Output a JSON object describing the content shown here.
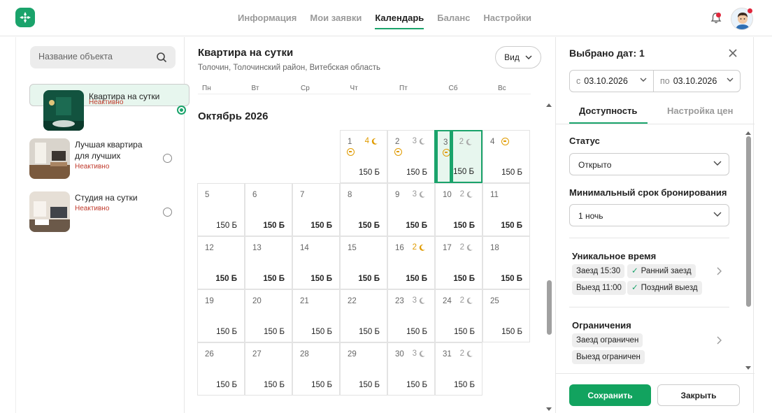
{
  "nav": {
    "items": [
      {
        "label": "Информация",
        "active": false
      },
      {
        "label": "Мои заявки",
        "active": false
      },
      {
        "label": "Календарь",
        "active": true
      },
      {
        "label": "Баланс",
        "active": false
      },
      {
        "label": "Настройки",
        "active": false
      }
    ]
  },
  "colors": {
    "accent": "#1aa36b",
    "warning": "#e09b00",
    "inactive": "#c0392b"
  },
  "search": {
    "placeholder": "Название объекта"
  },
  "objects": [
    {
      "name": "Квартира на сутки",
      "status": "Неактивно",
      "selected": true
    },
    {
      "name": "Лучшая квартира для лучших",
      "status": "Неактивно",
      "selected": false
    },
    {
      "name": "Студия на сутки",
      "status": "Неактивно",
      "selected": false
    }
  ],
  "calendar": {
    "title": "Квартира на сутки",
    "subtitle": "Толочин, Толочинский район, Витебская область",
    "view_label": "Вид",
    "weekdays": [
      "Пн",
      "Вт",
      "Ср",
      "Чт",
      "Пт",
      "Сб",
      "Вс"
    ],
    "month": "Октябрь 2026",
    "first_weekday_index": 3,
    "days": [
      {
        "d": "1",
        "nights": "4",
        "night_color": "orange",
        "blocked": true,
        "price": "150 Б",
        "bold": false
      },
      {
        "d": "2",
        "nights": "3",
        "night_color": "grey",
        "blocked": true,
        "price": "150 Б",
        "bold": false
      },
      {
        "d": "3",
        "nights": "2",
        "night_color": "grey",
        "blocked": true,
        "price": "150 Б",
        "bold": false,
        "selected": true
      },
      {
        "d": "4",
        "nights": "",
        "night_color": "",
        "blocked": true,
        "price": "150 Б",
        "bold": false
      },
      {
        "d": "5",
        "nights": "",
        "price": "150 Б",
        "bold": false
      },
      {
        "d": "6",
        "nights": "",
        "price": "150 Б",
        "bold": true
      },
      {
        "d": "7",
        "nights": "",
        "price": "150 Б",
        "bold": true
      },
      {
        "d": "8",
        "nights": "",
        "price": "150 Б",
        "bold": true
      },
      {
        "d": "9",
        "nights": "3",
        "night_color": "grey",
        "price": "150 Б",
        "bold": true
      },
      {
        "d": "10",
        "nights": "2",
        "night_color": "grey",
        "price": "150 Б",
        "bold": true
      },
      {
        "d": "11",
        "nights": "",
        "price": "150 Б",
        "bold": true
      },
      {
        "d": "12",
        "nights": "",
        "price": "150 Б",
        "bold": true
      },
      {
        "d": "13",
        "nights": "",
        "price": "150 Б",
        "bold": true
      },
      {
        "d": "14",
        "nights": "",
        "price": "150 Б",
        "bold": true
      },
      {
        "d": "15",
        "nights": "",
        "price": "150 Б",
        "bold": true
      },
      {
        "d": "16",
        "nights": "2",
        "night_color": "orange",
        "price": "150 Б",
        "bold": true
      },
      {
        "d": "17",
        "nights": "2",
        "night_color": "grey",
        "price": "150 Б",
        "bold": true
      },
      {
        "d": "18",
        "nights": "",
        "price": "150 Б",
        "bold": true
      },
      {
        "d": "19",
        "nights": "",
        "price": "150 Б",
        "bold": false
      },
      {
        "d": "20",
        "nights": "",
        "price": "150 Б",
        "bold": false
      },
      {
        "d": "21",
        "nights": "",
        "price": "150 Б",
        "bold": false
      },
      {
        "d": "22",
        "nights": "",
        "price": "150 Б",
        "bold": false
      },
      {
        "d": "23",
        "nights": "3",
        "night_color": "grey",
        "price": "150 Б",
        "bold": false
      },
      {
        "d": "24",
        "nights": "2",
        "night_color": "grey",
        "price": "150 Б",
        "bold": false
      },
      {
        "d": "25",
        "nights": "",
        "price": "150 Б",
        "bold": false
      },
      {
        "d": "26",
        "nights": "",
        "price": "150 Б",
        "bold": false
      },
      {
        "d": "27",
        "nights": "",
        "price": "150 Б",
        "bold": false
      },
      {
        "d": "28",
        "nights": "",
        "price": "150 Б",
        "bold": false
      },
      {
        "d": "29",
        "nights": "",
        "price": "150 Б",
        "bold": false
      },
      {
        "d": "30",
        "nights": "3",
        "night_color": "grey",
        "price": "150 Б",
        "bold": false
      },
      {
        "d": "31",
        "nights": "2",
        "night_color": "grey",
        "price": "150 Б",
        "bold": false
      }
    ]
  },
  "panel": {
    "title": "Выбрано дат: 1",
    "from_label": "с",
    "from_value": "03.10.2026",
    "to_label": "по",
    "to_value": "03.10.2026",
    "tab_availability": "Доступность",
    "tab_prices": "Настройка цен",
    "status_label": "Статус",
    "status_value": "Открыто",
    "min_label": "Минимальный срок бронирования",
    "min_value": "1 ночь",
    "unique_label": "Уникальное время",
    "checkin_chip": "Заезд 15:30",
    "early_chip": "Ранний заезд",
    "checkout_chip": "Выезд 11:00",
    "late_chip": "Поздний выезд",
    "restrict_label": "Ограничения",
    "restrict_in": "Заезд ограничен",
    "restrict_out": "Выезд ограничен",
    "save_label": "Сохранить",
    "close_label": "Закрыть"
  }
}
